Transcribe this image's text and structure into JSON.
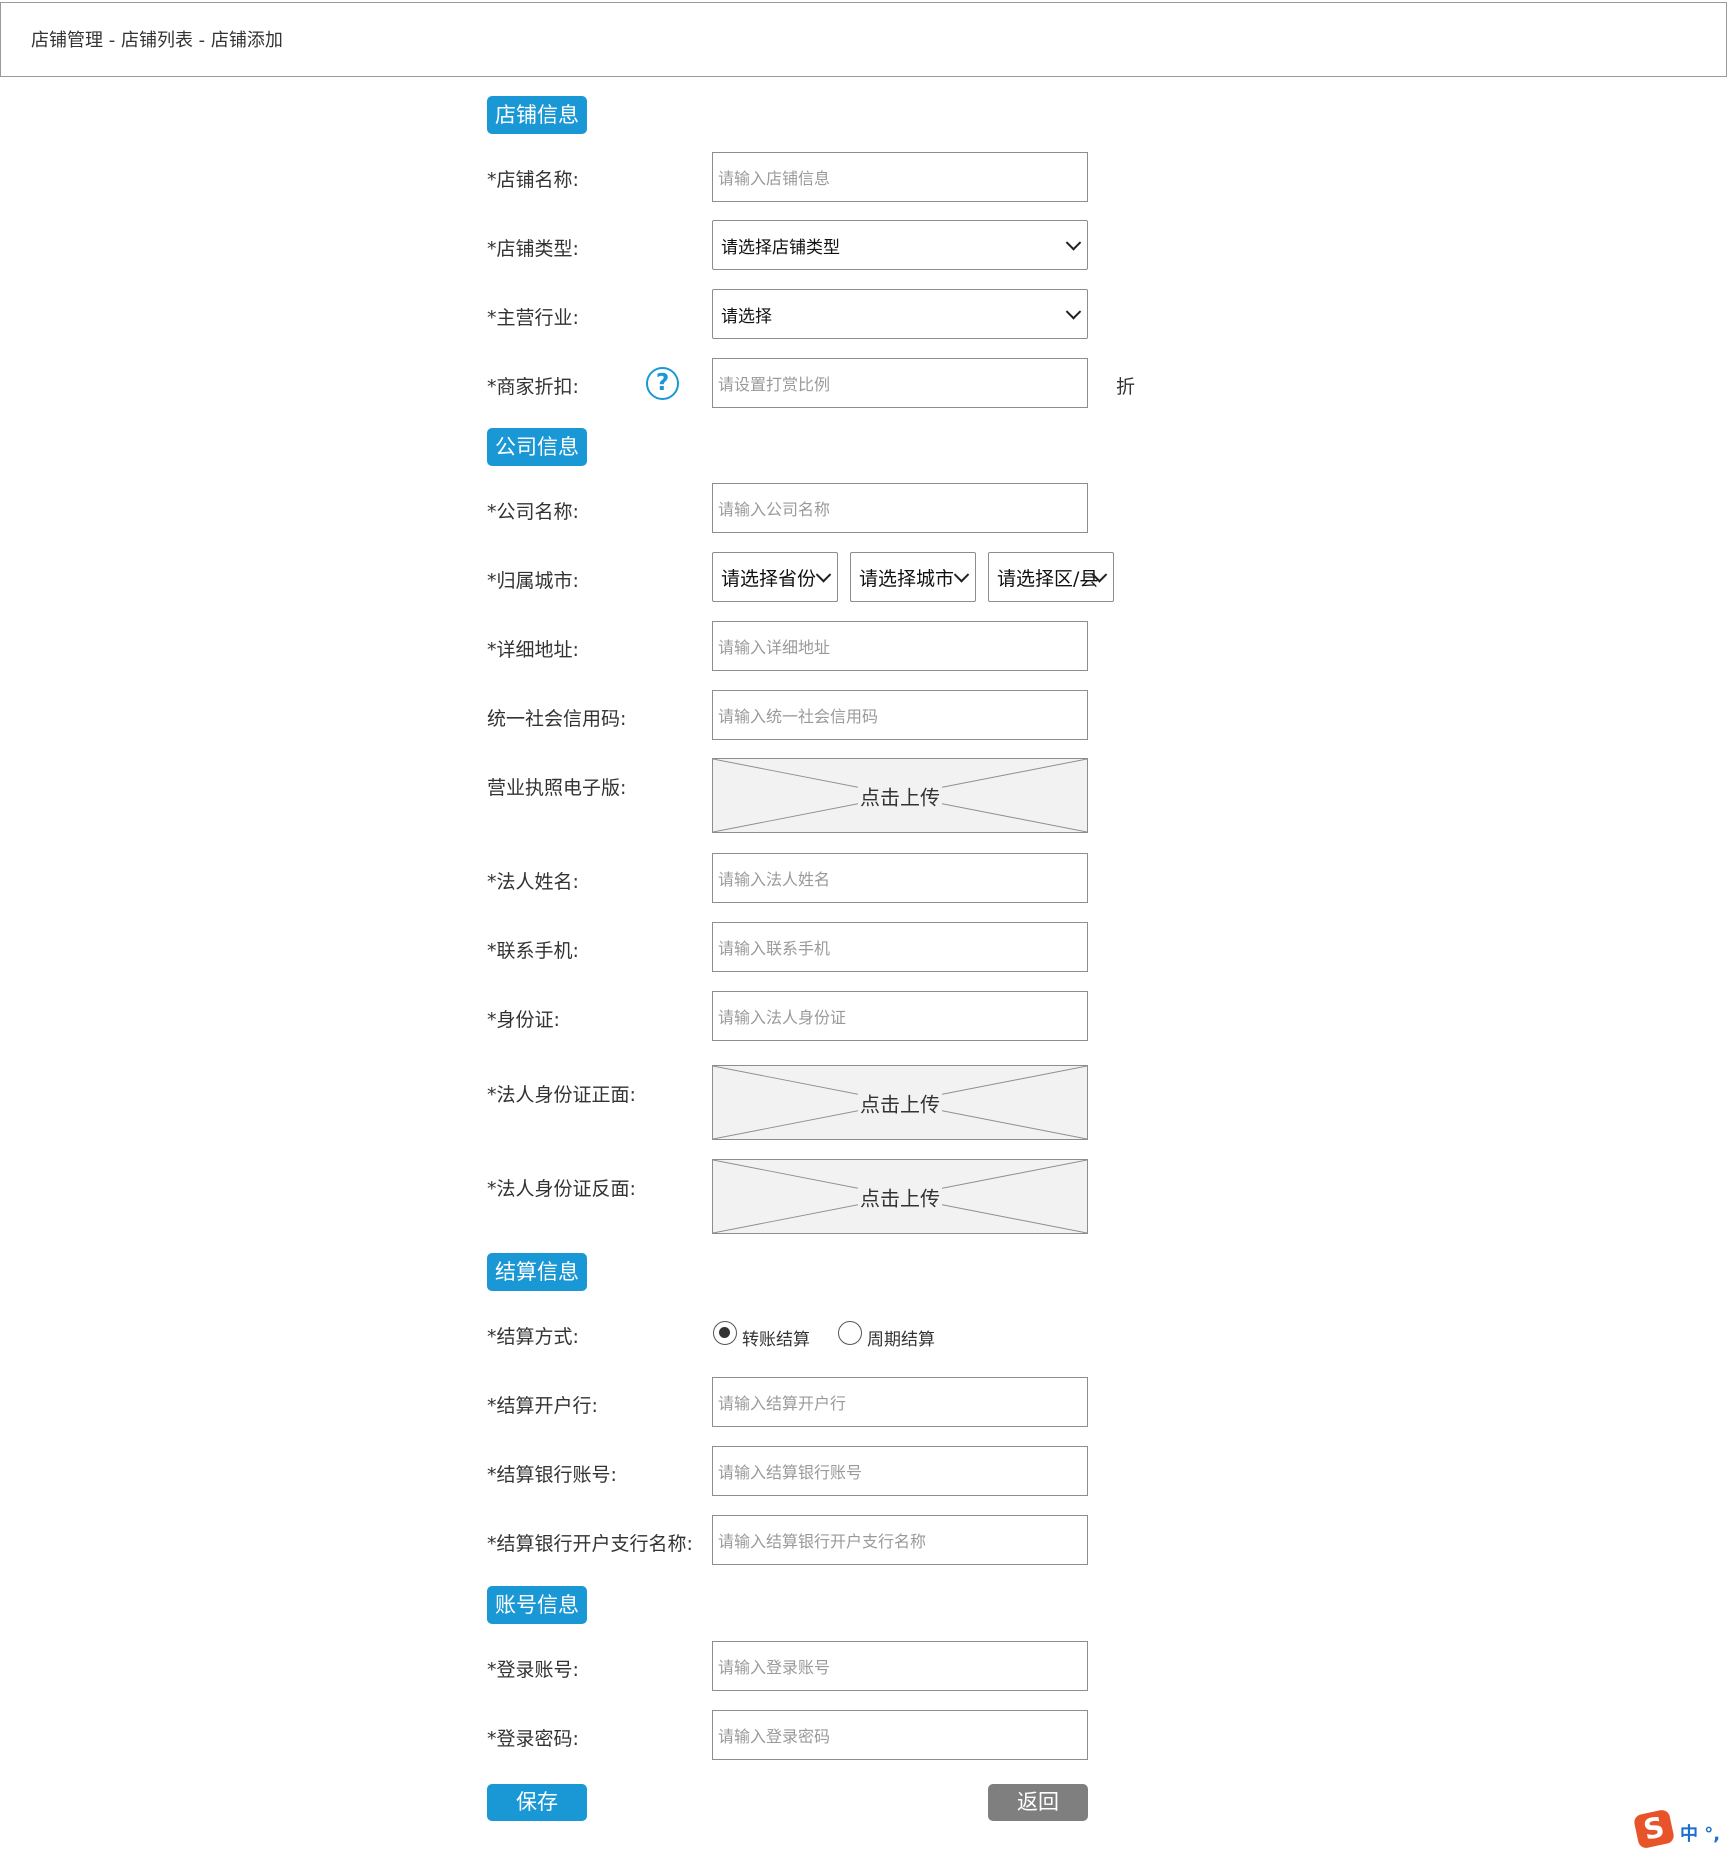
{
  "breadcrumb": "店铺管理 -  店铺列表 - 店铺添加",
  "sections": {
    "store": "店铺信息",
    "company": "公司信息",
    "settlement": "结算信息",
    "account": "账号信息"
  },
  "store": {
    "name_label": "*店铺名称:",
    "name_placeholder": "请输入店铺信息",
    "type_label": "*店铺类型:",
    "type_value": "请选择店铺类型",
    "industry_label": "*主营行业:",
    "industry_value": "请选择",
    "discount_label": "*商家折扣:",
    "discount_help": "?",
    "discount_placeholder": "请设置打赏比例",
    "discount_unit": "折"
  },
  "company": {
    "name_label": "*公司名称:",
    "name_placeholder": "请输入公司名称",
    "city_label": "*归属城市:",
    "province_value": "请选择省份",
    "city_value": "请选择城市",
    "district_value": "请选择区/县",
    "address_label": "*详细地址:",
    "address_placeholder": "请输入详细地址",
    "credit_label": "统一社会信用码:",
    "credit_placeholder": "请输入统一社会信用码",
    "license_label": "营业执照电子版:",
    "upload_text": "点击上传",
    "legal_name_label": "*法人姓名:",
    "legal_name_placeholder": "请输入法人姓名",
    "phone_label": "*联系手机:",
    "phone_placeholder": "请输入联系手机",
    "id_label": "*身份证:",
    "id_placeholder": "请输入法人身份证",
    "id_front_label": "*法人身份证正面:",
    "id_back_label": "*法人身份证反面:"
  },
  "settlement": {
    "method_label": "*结算方式:",
    "option_transfer": "转账结算",
    "option_periodic": "周期结算",
    "selected": "转账结算",
    "bank_label": "*结算开户行:",
    "bank_placeholder": "请输入结算开户行",
    "account_label": "*结算银行账号:",
    "account_placeholder": "请输入结算银行账号",
    "branch_label": "*结算银行开户支行名称:",
    "branch_placeholder": "请输入结算银行开户支行名称"
  },
  "account": {
    "login_label": "*登录账号:",
    "login_placeholder": "请输入登录账号",
    "password_label": "*登录密码:",
    "password_placeholder": "请输入登录密码"
  },
  "buttons": {
    "save": "保存",
    "back": "返回"
  },
  "ime": {
    "logo": "S",
    "text": "中 °,"
  },
  "colors": {
    "accent": "#1a98d5",
    "back_button": "#7f7f7f",
    "border": "#8d8d8d",
    "upload_bg": "#f2f2f2"
  }
}
